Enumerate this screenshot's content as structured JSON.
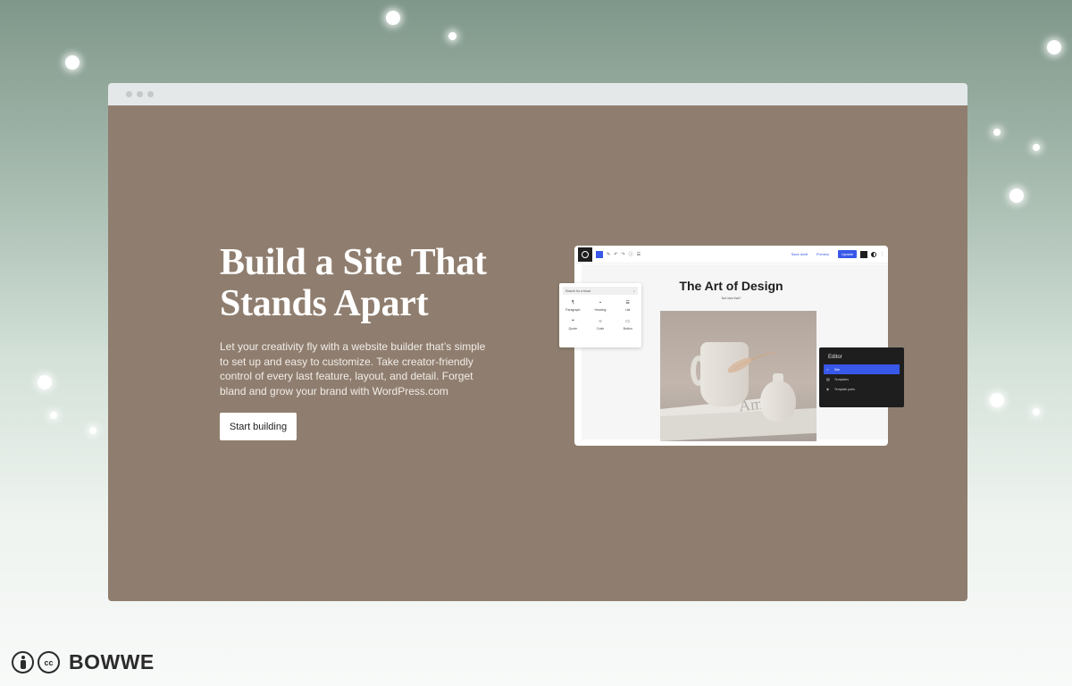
{
  "hero": {
    "title_line1": "Build a Site That",
    "title_line2": "Stands Apart",
    "description": "Let your creativity fly with a website builder that’s simple to set up and easy to customize. Take creator-friendly control of every last feature, layout, and detail. Forget bland and grow your brand with WordPress.com",
    "cta_label": "Start building"
  },
  "editor_mockup": {
    "toolbar": {
      "save_draft": "Save draft",
      "preview": "Preview",
      "update": "Update"
    },
    "page_title": "The Art of Design",
    "page_subtitle": "Not idea that?",
    "photo_book_text": "Am",
    "inserter": {
      "search_placeholder": "Search for a block",
      "blocks": [
        {
          "label": "Paragraph",
          "icon": "¶"
        },
        {
          "label": "Heading",
          "icon": "▪"
        },
        {
          "label": "List",
          "icon": "☰"
        },
        {
          "label": "Quote",
          "icon": "❝"
        },
        {
          "label": "Code",
          "icon": "‹›"
        },
        {
          "label": "Button",
          "icon": "▭"
        }
      ]
    },
    "editor_panel": {
      "title": "Editor",
      "items": [
        {
          "label": "Site",
          "icon": "⌂",
          "active": true
        },
        {
          "label": "Templates",
          "icon": "▤",
          "active": false
        },
        {
          "label": "Template parts",
          "icon": "◈",
          "active": false
        }
      ]
    }
  },
  "footer": {
    "cc_label": "cc",
    "brand": "BOWWE"
  },
  "colors": {
    "hero_background": "#8f7e6f",
    "accent_blue": "#3858e9",
    "panel_dark": "#1e1e1e"
  }
}
